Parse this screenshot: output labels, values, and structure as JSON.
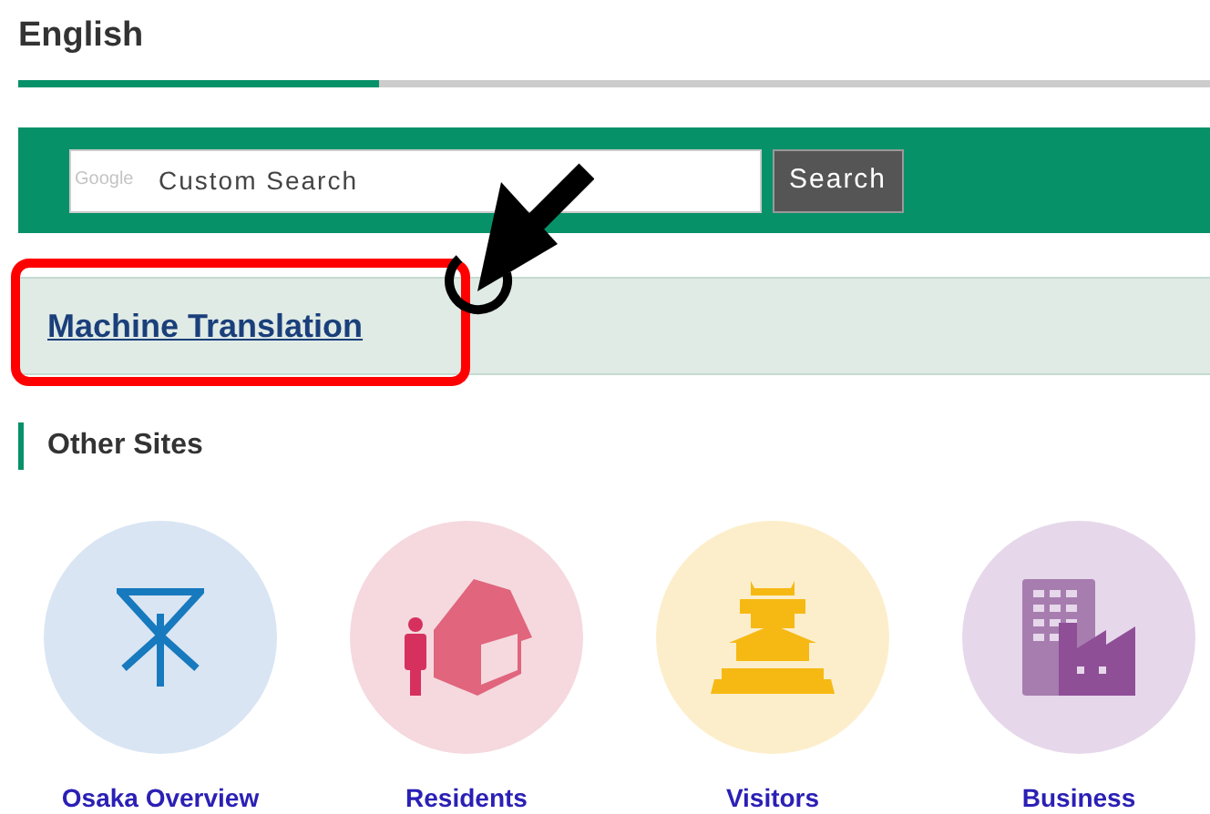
{
  "heading": "English",
  "search": {
    "brand": "Google",
    "placeholder": "Custom Search",
    "button": "Search"
  },
  "machine_translation": {
    "label": "Machine Translation"
  },
  "other_sites": {
    "title": "Other Sites",
    "items": [
      {
        "label": "Osaka Overview",
        "kind": "tower",
        "color": "#d9e5f3"
      },
      {
        "label": "Residents",
        "kind": "house",
        "color": "#f5d9de"
      },
      {
        "label": "Visitors",
        "kind": "castle",
        "color": "#fdeecb"
      },
      {
        "label": "Business",
        "kind": "building",
        "color": "#e6d8ea"
      }
    ]
  }
}
